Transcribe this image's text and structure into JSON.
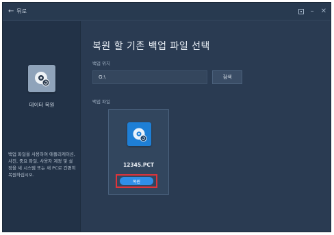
{
  "titlebar": {
    "back_icon": "arrow-left-icon",
    "back_label": "뒤로",
    "controls": [
      "restore-box-icon",
      "minimize-icon",
      "close-icon"
    ]
  },
  "sidebar": {
    "icon": "data-restore-disk-icon",
    "label": "데이터 복원",
    "description": "백업 파일을 사용하여 애플리케이션, 사진, 중요 파일, 사용자 계정 및 설정을 새 시스템 또는 새 PC로 간편히 복원하십시오."
  },
  "main": {
    "title": "복원 할 기존 백업 파일 선택",
    "location_label": "백업 위치",
    "location_value": "G:\\",
    "search_label": "검색",
    "files_label": "백업 파일",
    "file": {
      "icon": "backup-disk-icon",
      "name": "12345.PCT",
      "restore_label": "복원"
    }
  },
  "colors": {
    "window_bg": "#2a3b52",
    "sidebar_bg": "#223247",
    "accent_blue": "#2f8fe8",
    "highlight_red": "#e0343a"
  }
}
